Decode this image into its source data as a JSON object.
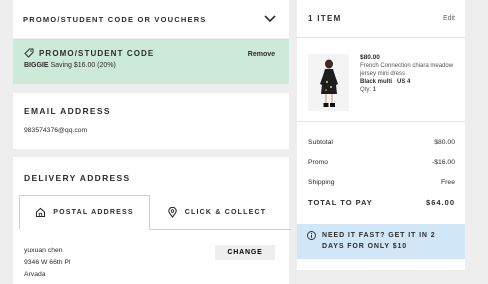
{
  "promo_header": {
    "title": "PROMO/STUDENT CODE OR VOUCHERS"
  },
  "promo_applied": {
    "title": "PROMO/STUDENT CODE",
    "remove_label": "Remove",
    "code": "BIGGIE",
    "saving_text": "Saving $16.00 (20%)"
  },
  "email": {
    "title": "EMAIL ADDRESS",
    "value": "983574376@qq.com"
  },
  "delivery": {
    "title": "DELIVERY ADDRESS",
    "tabs": [
      {
        "label": "POSTAL ADDRESS",
        "icon": "house-icon",
        "active": true
      },
      {
        "label": "CLICK & COLLECT",
        "icon": "map-pin-icon",
        "active": false
      }
    ],
    "address_lines": [
      "yuxuan chen",
      "9346 W 66th Pl",
      "Arvada"
    ],
    "change_label": "CHANGE"
  },
  "order": {
    "items_title": "1 ITEM",
    "edit_label": "Edit",
    "product": {
      "price": "$80.00",
      "name": "French Connection chiara meadow jersey mini dress",
      "color": "Black multi",
      "size": "US 4",
      "qty_label": "Qty:",
      "qty": "1"
    },
    "totals": [
      {
        "label": "Subtotal",
        "value": "$80.00"
      },
      {
        "label": "Promo",
        "value": "-$16.00"
      },
      {
        "label": "Shipping",
        "value": "Free"
      }
    ],
    "total": {
      "label": "TOTAL TO PAY",
      "value": "$64.00"
    },
    "fast_banner": "NEED IT FAST? GET IT IN 2 DAYS FOR ONLY $10"
  },
  "colors": {
    "promo_bg": "#cce9d9",
    "banner_bg": "#d1e6f7",
    "page_bg": "#eeeeee"
  }
}
